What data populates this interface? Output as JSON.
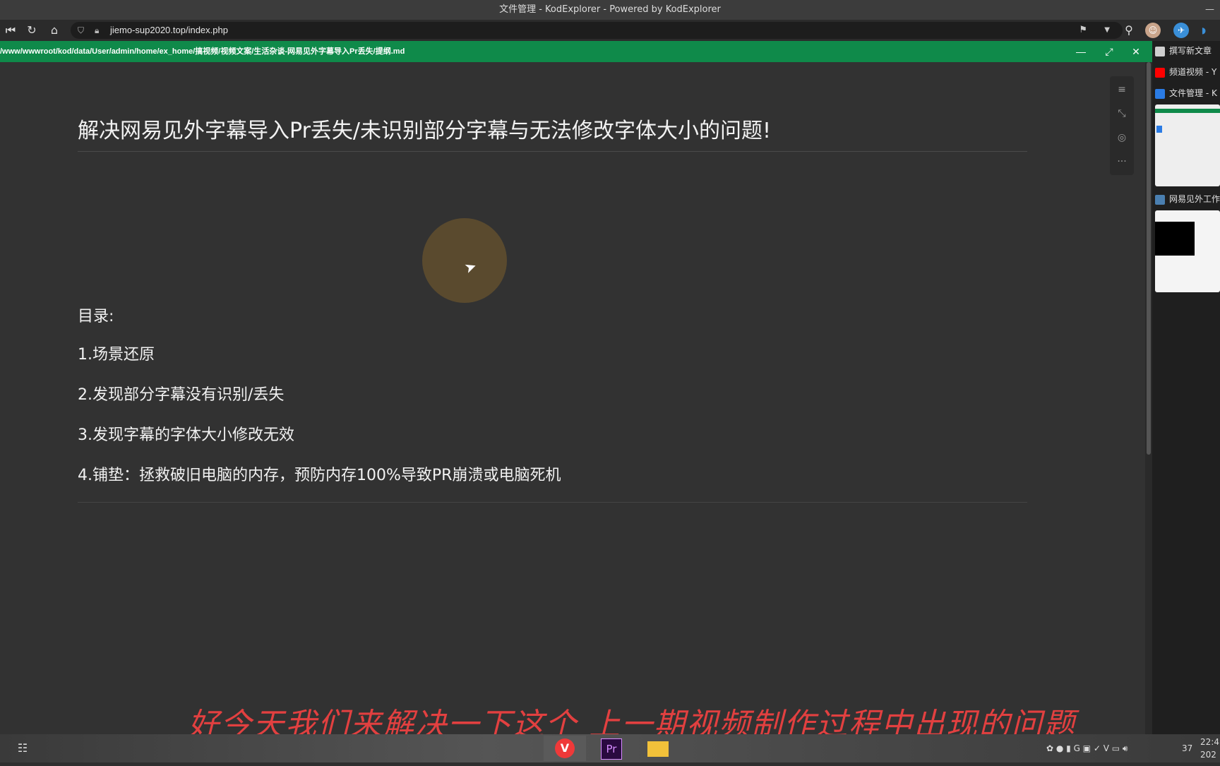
{
  "window": {
    "title": "文件管理 - KodExplorer - Powered by KodExplorer",
    "min_glyph": "—"
  },
  "browser": {
    "url": "jiemo-sup2020.top/index.php"
  },
  "editor": {
    "path": "/www/wwwroot/kod/data/User/admin/home/ex_home/搞视频/视频文案/生活杂谈-网易见外字幕导入Pr丢失/提纲.md"
  },
  "document": {
    "title": "解决网易见外字幕导入Pr丢失/未识别部分字幕与无法修改字体大小的问题!",
    "toc_heading": "目录:",
    "toc_items": [
      "1.场景还原",
      "2.发现部分字幕没有识别/丢失",
      "3.发现字幕的字体大小修改无效",
      "4.铺垫：拯救破旧电脑的内存，预防内存100%导致PR崩溃或电脑死机"
    ]
  },
  "side_tabs": [
    {
      "label": "撰写新文章",
      "icon": "doc-icon",
      "color": "#cfcfcf"
    },
    {
      "label": "频道视频 - Y",
      "icon": "youtube-icon",
      "color": "#ff0000"
    },
    {
      "label": "文件管理 - K",
      "icon": "kod-icon",
      "color": "#2a7be4"
    },
    {
      "label": "网易见外工作",
      "icon": "netease-icon",
      "color": "#4a7fb0"
    }
  ],
  "video_subtitle": "好今天我们来解决一下这个 上一期视频制作过程中出现的问题",
  "taskbar": {
    "apps": [
      {
        "name": "vivaldi",
        "glyph": "V"
      },
      {
        "name": "premiere",
        "glyph": "Pr"
      },
      {
        "name": "file-explorer",
        "glyph": "▬"
      }
    ],
    "tray_temp": "37",
    "clock_time": "22:4",
    "clock_date": "202"
  }
}
